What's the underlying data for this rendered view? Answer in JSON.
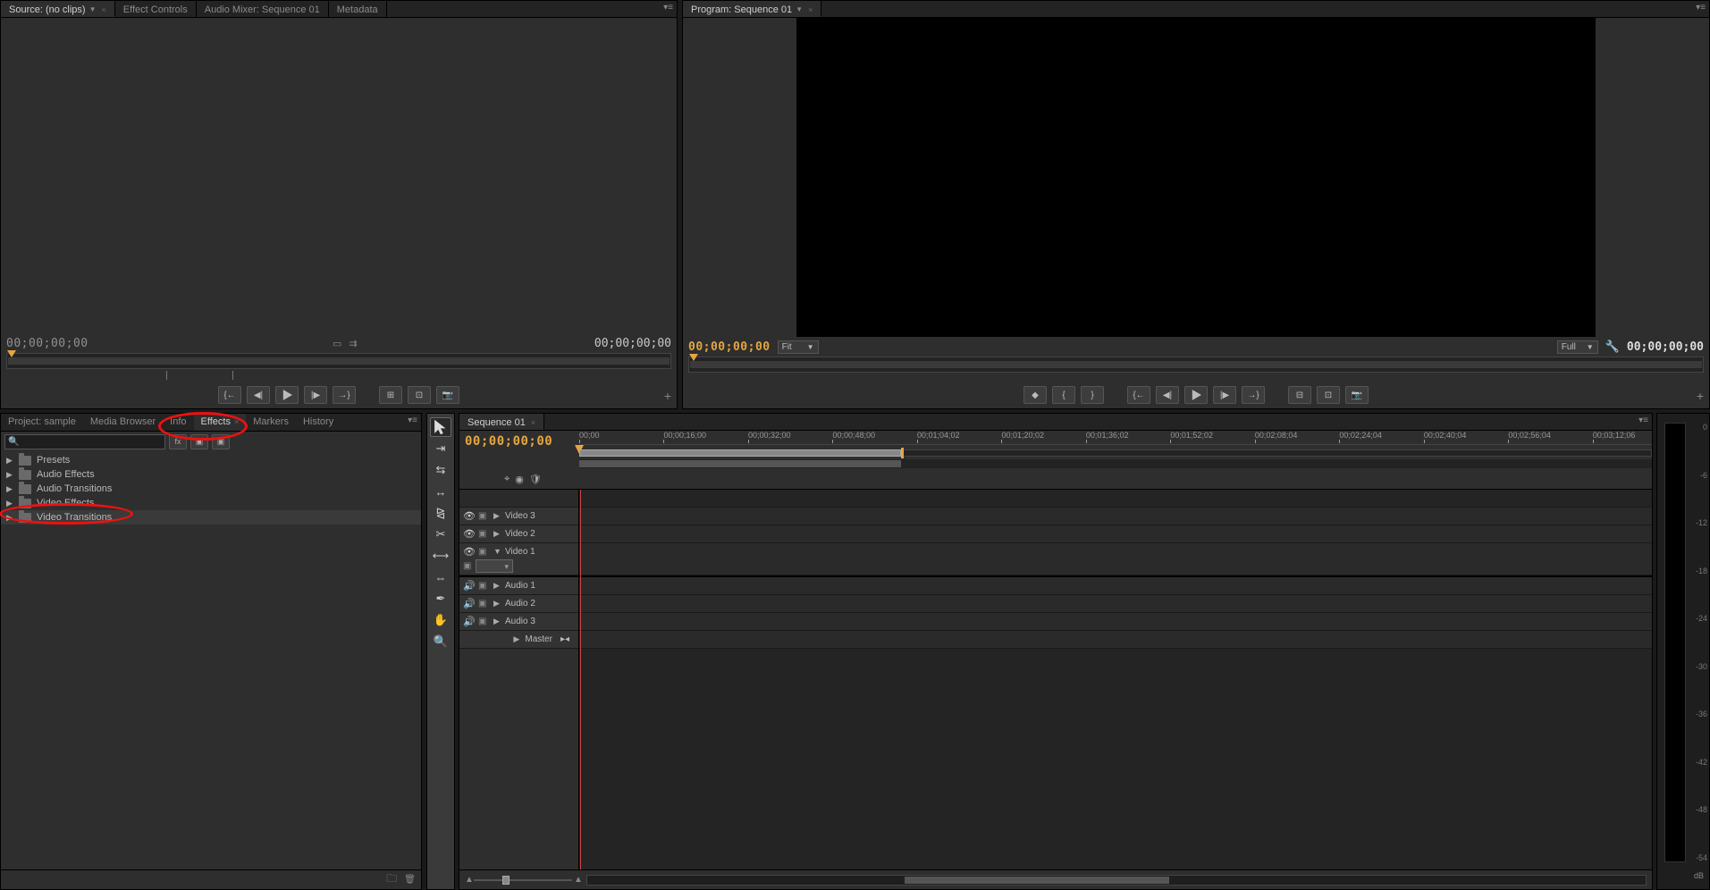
{
  "source": {
    "tabs": [
      {
        "label": "Source: (no clips)",
        "active": true,
        "dropdown": true,
        "closable": true
      },
      {
        "label": "Effect Controls"
      },
      {
        "label": "Audio Mixer: Sequence 01"
      },
      {
        "label": "Metadata"
      }
    ],
    "tc_left": "00;00;00;00",
    "tc_right": "00;00;00;00"
  },
  "program": {
    "tabs": [
      {
        "label": "Program: Sequence 01",
        "active": true,
        "dropdown": true,
        "closable": true
      }
    ],
    "tc_left": "00;00;00;00",
    "fit_label": "Fit",
    "quality_label": "Full",
    "tc_right": "00;00;00;00"
  },
  "project": {
    "tabs": [
      {
        "label": "Project: sample"
      },
      {
        "label": "Media Browser"
      },
      {
        "label": "Info"
      },
      {
        "label": "Effects",
        "active": true,
        "closable": true
      },
      {
        "label": "Markers"
      },
      {
        "label": "History"
      }
    ],
    "search_placeholder": "",
    "tree": [
      {
        "label": "Presets"
      },
      {
        "label": "Audio Effects"
      },
      {
        "label": "Audio Transitions"
      },
      {
        "label": "Video Effects"
      },
      {
        "label": "Video Transitions",
        "selected": true
      }
    ]
  },
  "timeline": {
    "tabs": [
      {
        "label": "Sequence 01",
        "active": true,
        "closable": true
      }
    ],
    "tc": "00;00;00;00",
    "ruler": [
      "00;00",
      "00;00;16;00",
      "00;00;32;00",
      "00;00;48;00",
      "00;01;04;02",
      "00;01;20;02",
      "00;01;36;02",
      "00;01;52;02",
      "00;02;08;04",
      "00;02;24;04",
      "00;02;40;04",
      "00;02;56;04",
      "00;03;12;06"
    ],
    "video_tracks": [
      {
        "label": "Video 3",
        "open": false
      },
      {
        "label": "Video 2",
        "open": false
      },
      {
        "label": "Video 1",
        "open": true
      }
    ],
    "audio_tracks": [
      {
        "label": "Audio 1",
        "open": false
      },
      {
        "label": "Audio 2",
        "open": false
      },
      {
        "label": "Audio 3",
        "open": false
      }
    ],
    "master_label": "Master"
  },
  "audiometer": {
    "scale": [
      "0",
      "-6",
      "-12",
      "-18",
      "-24",
      "-30",
      "-36",
      "-42",
      "-48",
      "-54"
    ],
    "unit": "dB"
  }
}
